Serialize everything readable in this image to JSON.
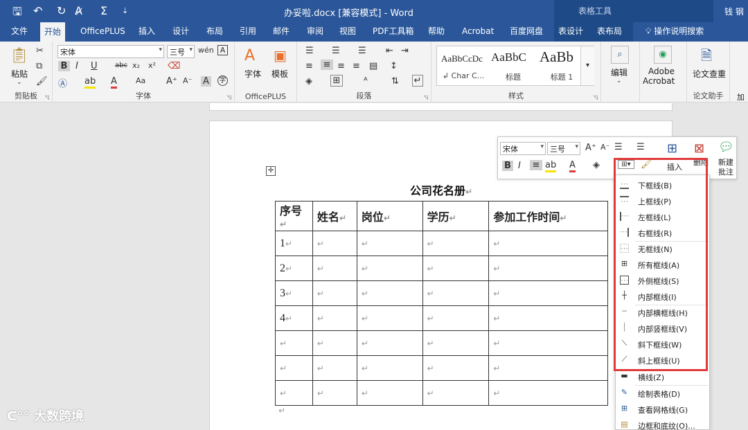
{
  "titlebar": {
    "document_title": "办妥啦.docx [兼容模式]  -  Word",
    "context_label": "表格工具",
    "user_name": "钱 钢"
  },
  "tabs": [
    "文件",
    "开始",
    "OfficePLUS",
    "插入",
    "设计",
    "布局",
    "引用",
    "邮件",
    "审阅",
    "视图",
    "PDF工具箱",
    "帮助",
    "Acrobat",
    "百度网盘",
    "表设计",
    "表布局"
  ],
  "active_tab": "开始",
  "tell_me": "操作说明搜索",
  "ribbon": {
    "clipboard": {
      "paste_label": "粘贴",
      "group_label": "剪贴板"
    },
    "font": {
      "font_name": "宋体",
      "font_size": "三号",
      "group_label": "字体"
    },
    "officeplus": {
      "font_label": "字体",
      "template_label": "模板",
      "group_label": "OfficePLUS"
    },
    "paragraph": {
      "group_label": "段落"
    },
    "styles": {
      "group_label": "样式",
      "items": [
        {
          "sample": "AaBbCcDc",
          "name": "↲ Char C..."
        },
        {
          "sample": "AaBbC",
          "name": "标题"
        },
        {
          "sample": "AaBb",
          "name": "标题 1"
        }
      ]
    },
    "editing": {
      "label": "编辑"
    },
    "acrobat": {
      "label1": "Adobe",
      "label2": "Acrobat"
    },
    "paper": {
      "label": "论文查重",
      "group_label": "论文助手",
      "extra": "加"
    }
  },
  "document": {
    "title": "公司花名册",
    "header_row": [
      "序号",
      "姓名",
      "岗位",
      "学历",
      "参加工作时间"
    ],
    "rows": [
      [
        "1",
        "",
        "",
        "",
        ""
      ],
      [
        "2",
        "",
        "",
        "",
        ""
      ],
      [
        "3",
        "",
        "",
        "",
        ""
      ],
      [
        "4",
        "",
        "",
        "",
        ""
      ],
      [
        "",
        "",
        "",
        "",
        ""
      ],
      [
        "",
        "",
        "",
        "",
        ""
      ],
      [
        "",
        "",
        "",
        "",
        ""
      ]
    ],
    "paragraph_mark": "↵"
  },
  "mini_toolbar": {
    "font_name": "宋体",
    "font_size": "三号",
    "insert_label": "插入",
    "delete_label": "删除",
    "new_comment_line1": "新建",
    "new_comment_line2": "批注"
  },
  "border_menu": [
    {
      "label": "下框线(B)",
      "icon": "border-bottom-icon"
    },
    {
      "label": "上框线(P)",
      "icon": "border-top-icon"
    },
    {
      "label": "左框线(L)",
      "icon": "border-left-icon"
    },
    {
      "label": "右框线(R)",
      "icon": "border-right-icon"
    },
    {
      "label": "无框线(N)",
      "icon": "border-none-icon"
    },
    {
      "label": "所有框线(A)",
      "icon": "border-all-icon"
    },
    {
      "label": "外侧框线(S)",
      "icon": "border-outside-icon"
    },
    {
      "label": "内部框线(I)",
      "icon": "border-inside-icon"
    },
    {
      "label": "内部横框线(H)",
      "icon": "border-inside-horizontal-icon"
    },
    {
      "label": "内部竖框线(V)",
      "icon": "border-inside-vertical-icon"
    },
    {
      "label": "斜下框线(W)",
      "icon": "diagonal-down-icon"
    },
    {
      "label": "斜上框线(U)",
      "icon": "diagonal-up-icon"
    },
    {
      "label": "横线(Z)",
      "icon": "horizontal-line-icon"
    },
    {
      "label": "绘制表格(D)",
      "icon": "draw-table-icon"
    },
    {
      "label": "查看网格线(G)",
      "icon": "view-gridlines-icon"
    },
    {
      "label": "边框和底纹(O)...",
      "icon": "borders-shading-icon"
    }
  ],
  "watermark": "大数跨境",
  "colors": {
    "word_blue": "#2b579a",
    "highlight_red": "#e03a3a"
  }
}
